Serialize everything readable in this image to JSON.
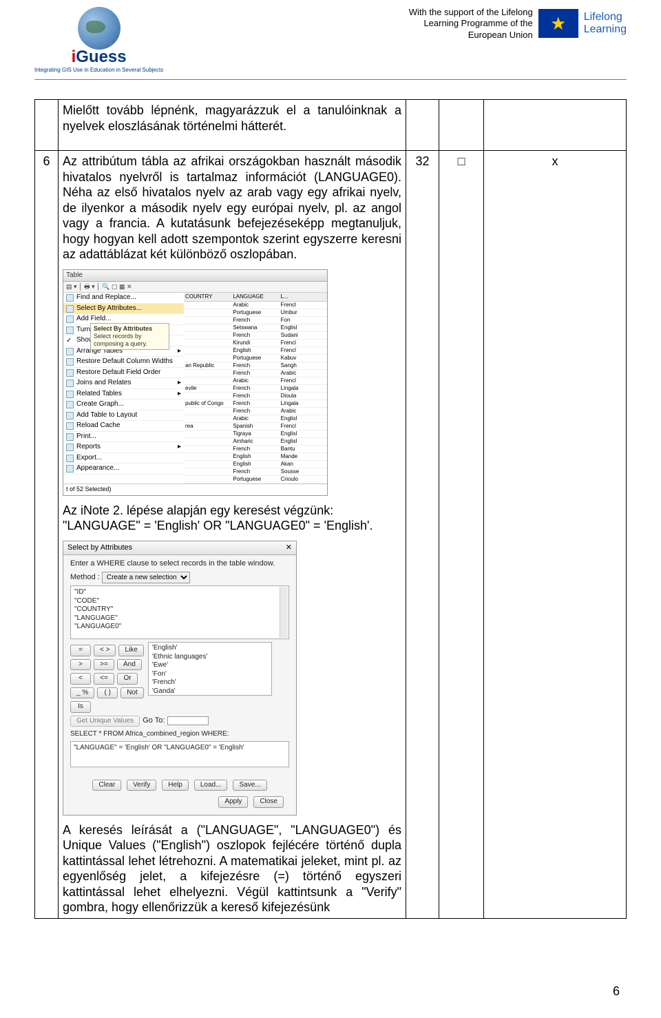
{
  "header": {
    "logo_text_i": "i",
    "logo_text_g": "G",
    "logo_text_rest": "uess",
    "logo_sub": "Integrating GIS Use in Education in Several Subjects",
    "support_line1": "With the support of the Lifelong",
    "support_line2": "Learning Programme of the",
    "support_line3": "European Union",
    "lifelong1": "Lifelong",
    "lifelong2": "Learning",
    "eu_stars": "★"
  },
  "row1": {
    "text": "Mielőtt tovább lépnénk, magyarázzuk el a tanulóinknak a nyelvek eloszlásának történelmi hátterét."
  },
  "row2": {
    "num": "6",
    "para": "Az attribútum tábla az afrikai országokban használt második hivatalos nyelvről is tartalmaz információt (LANGUAGE0). Néha az első hivatalos nyelv az arab vagy egy afrikai nyelv, de ilyenkor a második nyelv egy európai nyelv, pl. az angol vagy a francia. A kutatásunk befejezéseképp megtanuljuk, hogy hogyan kell adott szempontok szerint egyszerre keresni az adattáblázat két különböző oszlopában.",
    "colA": "32",
    "colB": "□",
    "colC": "x",
    "mid1": "Az iNote 2. lépése alapján egy keresést végzünk:",
    "mid2": "\"LANGUAGE\" = 'English' OR \"LANGUAGE0\" = 'English'.",
    "bottom": "A keresés leírását a (\"LANGUAGE\", \"LANGUAGE0\") és Unique Values (\"English\") oszlopok fejlécére történő dupla kattintással lehet létrehozni. A matematikai jeleket, mint pl. az egyenlőség jelet, a kifejezésre (=) történő egyszeri kattintással lehet elhelyezni. Végül kattintsunk a \"Verify\" gombra, hogy ellenőrizzük a kereső kifejezésünk"
  },
  "fig1": {
    "title": "Table",
    "findreplace": "Find and Replace...",
    "selbyattr": "Select By Attributes...",
    "tooltip_title": "Select By Attributes",
    "tooltip_body": "Select records by composing a query.",
    "menu": [
      "Add Field...",
      "Turn All Fields On",
      "Show Field Aliases",
      "Arrange Tables",
      "Restore Default Column Widths",
      "Restore Default Field Order",
      "Joins and Relates",
      "Related Tables",
      "Create Graph...",
      "Add Table to Layout",
      "Reload Cache",
      "Print...",
      "Reports",
      "Export...",
      "Appearance..."
    ],
    "columns": [
      "COUNTRY",
      "LANGUAGE",
      "L..."
    ],
    "data": [
      [
        "",
        "Arabic",
        "Frencl"
      ],
      [
        "",
        "Portuguese",
        "Umbur"
      ],
      [
        "",
        "French",
        "Fon"
      ],
      [
        "",
        "Setswana",
        "Englisl"
      ],
      [
        "",
        "French",
        "Sudani"
      ],
      [
        "",
        "Kirundi",
        "Frencl"
      ],
      [
        "",
        "English",
        "Frencl"
      ],
      [
        "",
        "Portuguese",
        "Kabuv"
      ],
      [
        "an Republic",
        "French",
        "Sangh"
      ],
      [
        "",
        "French",
        "Arabic"
      ],
      [
        "",
        "Arabic",
        "Frencl"
      ],
      [
        "evile",
        "French",
        "Lingala"
      ],
      [
        "",
        "French",
        "Dioula"
      ],
      [
        "public of Congo",
        "French",
        "Lingala"
      ],
      [
        "",
        "French",
        "Arabic"
      ],
      [
        "",
        "Arabic",
        "Englisl"
      ],
      [
        "rea",
        "Spanish",
        "Frencl"
      ],
      [
        "",
        "Tigraya",
        "Englisl"
      ],
      [
        "",
        "Amharic",
        "Englisl"
      ],
      [
        "",
        "French",
        "Bantu"
      ],
      [
        "",
        "English",
        "Mande"
      ],
      [
        "",
        "English",
        "Akan"
      ],
      [
        "",
        "French",
        "Sousse"
      ],
      [
        "",
        "Portuguese",
        "Crioulo"
      ]
    ],
    "footer": "t of 52 Selected)"
  },
  "fig2": {
    "title": "Select by Attributes",
    "close": "✕",
    "intro": "Enter a WHERE clause to select records in the table window.",
    "method_label": "Method :",
    "method_value": "Create a new selection",
    "fields": [
      "\"ID\"",
      "\"CODE\"",
      "\"COUNTRY\"",
      "\"LANGUAGE\"",
      "\"LANGUAGE0\""
    ],
    "ops_row1": [
      "=",
      "< >",
      "Like"
    ],
    "ops_row2": [
      ">",
      ">=",
      "And"
    ],
    "ops_row3": [
      "<",
      "<=",
      "Or"
    ],
    "ops_row4": [
      "_ %",
      "( )",
      "Not"
    ],
    "is_btn": "Is",
    "guv": "Get Unique Values",
    "goto": "Go To:",
    "values": [
      "'English'",
      "'Ethnic languages'",
      "'Ewe'",
      "'Fon'",
      "'French'",
      "'Ganda'"
    ],
    "sql": "SELECT * FROM Africa_combined_region WHERE:",
    "expr": "\"LANGUAGE\" = 'English' OR \"LANGUAGE0\" = 'English'",
    "btns1": [
      "Clear",
      "Verify",
      "Help",
      "Load...",
      "Save..."
    ],
    "btns2": [
      "Apply",
      "Close"
    ]
  },
  "page_number": "6"
}
